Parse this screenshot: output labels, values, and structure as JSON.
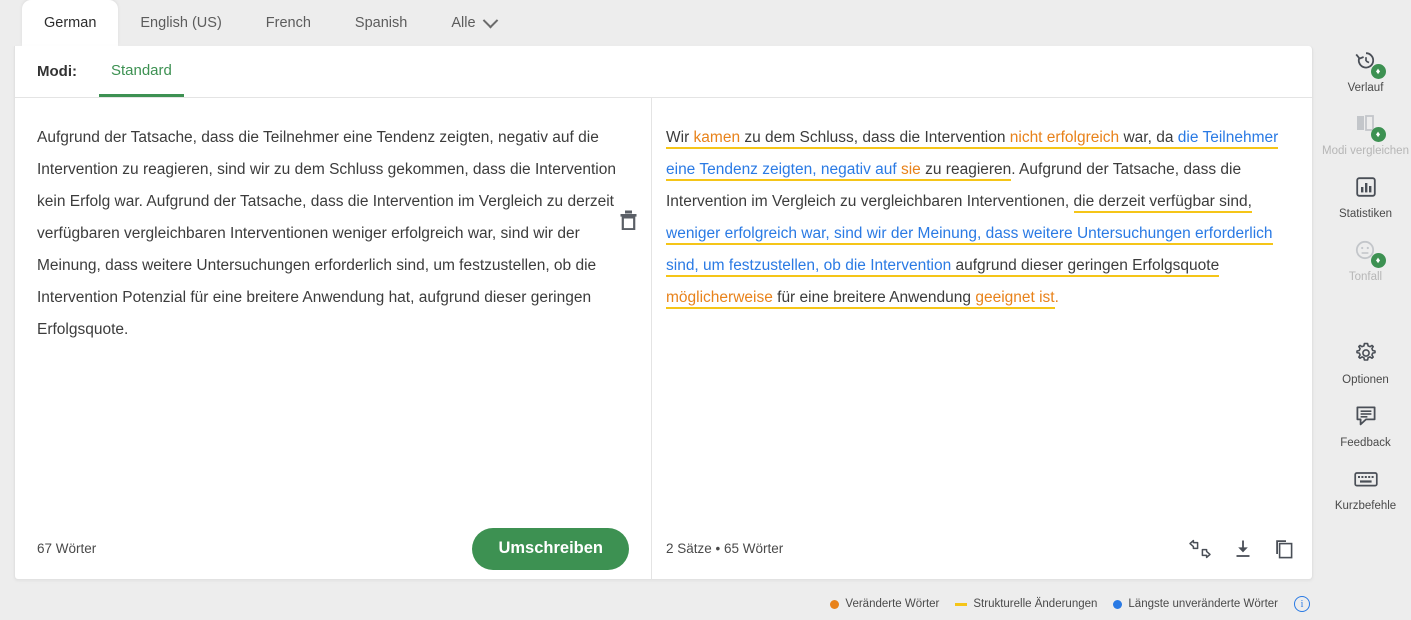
{
  "language_tabs": [
    {
      "label": "German",
      "active": true
    },
    {
      "label": "English (US)",
      "active": false
    },
    {
      "label": "French",
      "active": false
    },
    {
      "label": "Spanish",
      "active": false
    },
    {
      "label": "Alle",
      "active": false,
      "has_caret": true
    }
  ],
  "modes": {
    "label": "Modi:",
    "selected": "Standard"
  },
  "input_panel": {
    "text": "Aufgrund der Tatsache, dass die Teilnehmer eine Tendenz zeigten, negativ auf die Intervention zu reagieren, sind wir zu dem Schluss gekommen, dass die Intervention kein Erfolg war. Aufgrund der Tatsache, dass die Intervention im Vergleich zu derzeit verfügbaren vergleichbaren Interventionen weniger erfolgreich war, sind wir der Meinung, dass weitere Untersuchungen erforderlich sind, um festzustellen, ob die Intervention Potenzial für eine breitere Anwendung hat, aufgrund dieser geringen Erfolgsquote.",
    "word_count": "67 Wörter",
    "delete_icon": "trash-icon",
    "rewrite_button": "Umschreiben"
  },
  "output_panel": {
    "tokens": [
      {
        "t": "Wir ",
        "c": "plain",
        "u": true
      },
      {
        "t": "kamen",
        "c": "orange",
        "u": true
      },
      {
        "t": " zu dem Schluss, dass die Intervention ",
        "c": "plain",
        "u": true
      },
      {
        "t": "nicht erfolgreich",
        "c": "orange",
        "u": true
      },
      {
        "t": " war, da ",
        "c": "plain",
        "u": true
      },
      {
        "t": "die Teilnehmer eine Tendenz zeigten, negativ auf ",
        "c": "blue",
        "u": true
      },
      {
        "t": "sie",
        "c": "orange",
        "u": true
      },
      {
        "t": " zu reagieren",
        "c": "plain",
        "u": true
      },
      {
        "t": ". Aufgrund der Tatsache, dass die Intervention im Vergleich zu vergleichbaren Interventionen, ",
        "c": "plain",
        "u": false
      },
      {
        "t": "die derzeit verfügbar sind, ",
        "c": "plain",
        "u": true
      },
      {
        "t": "weniger erfolgreich war, sind wir der Meinung, dass weitere Untersuchungen erforderlich sind, um festzustellen, ob die Intervention",
        "c": "blue",
        "u": true
      },
      {
        "t": " aufgrund dieser geringen Erfolgsquote ",
        "c": "plain",
        "u": true
      },
      {
        "t": "möglicherweise",
        "c": "orange",
        "u": true
      },
      {
        "t": " für eine breitere Anwendung ",
        "c": "plain",
        "u": true
      },
      {
        "t": "geeignet ist",
        "c": "orange",
        "u": true
      },
      {
        "t": ".",
        "c": "orange",
        "u": false
      }
    ],
    "stats": "2 Sätze • 65 Wörter",
    "sentence_count": "2 Sätze",
    "word_count": "65 Wörter",
    "actions": [
      {
        "name": "feedback-thumbs-icon",
        "label": "Feedback"
      },
      {
        "name": "download-icon",
        "label": "Herunterladen"
      },
      {
        "name": "copy-icon",
        "label": "Kopieren"
      }
    ]
  },
  "sidebar": {
    "items": [
      {
        "label": "Verlauf",
        "icon": "history-icon",
        "premium": true,
        "disabled": false
      },
      {
        "label": "Modi vergleichen",
        "icon": "compare-modes-icon",
        "premium": true,
        "disabled": true
      },
      {
        "label": "Statistiken",
        "icon": "statistics-icon",
        "premium": false,
        "disabled": false
      },
      {
        "label": "Tonfall",
        "icon": "tone-icon",
        "premium": true,
        "disabled": true
      },
      {
        "label": "Optionen",
        "icon": "gear-icon",
        "premium": false,
        "disabled": false
      },
      {
        "label": "Feedback",
        "icon": "speech-bubble-icon",
        "premium": false,
        "disabled": false
      },
      {
        "label": "Kurzbefehle",
        "icon": "keyboard-icon",
        "premium": false,
        "disabled": false
      }
    ]
  },
  "legend": {
    "items": [
      {
        "label": "Veränderte Wörter",
        "marker": "dot",
        "color": "#e8821a"
      },
      {
        "label": "Strukturelle Änderungen",
        "marker": "dash",
        "color": "#f5c518"
      },
      {
        "label": "Längste unveränderte Wörter",
        "marker": "dot",
        "color": "#2a7ae4"
      }
    ],
    "info_icon": "info-icon",
    "info_glyph": "i"
  },
  "colors": {
    "accent_green": "#3d9152",
    "changed_words": "#e8821a",
    "structural": "#f5c518",
    "unchanged": "#2a7ae4"
  }
}
